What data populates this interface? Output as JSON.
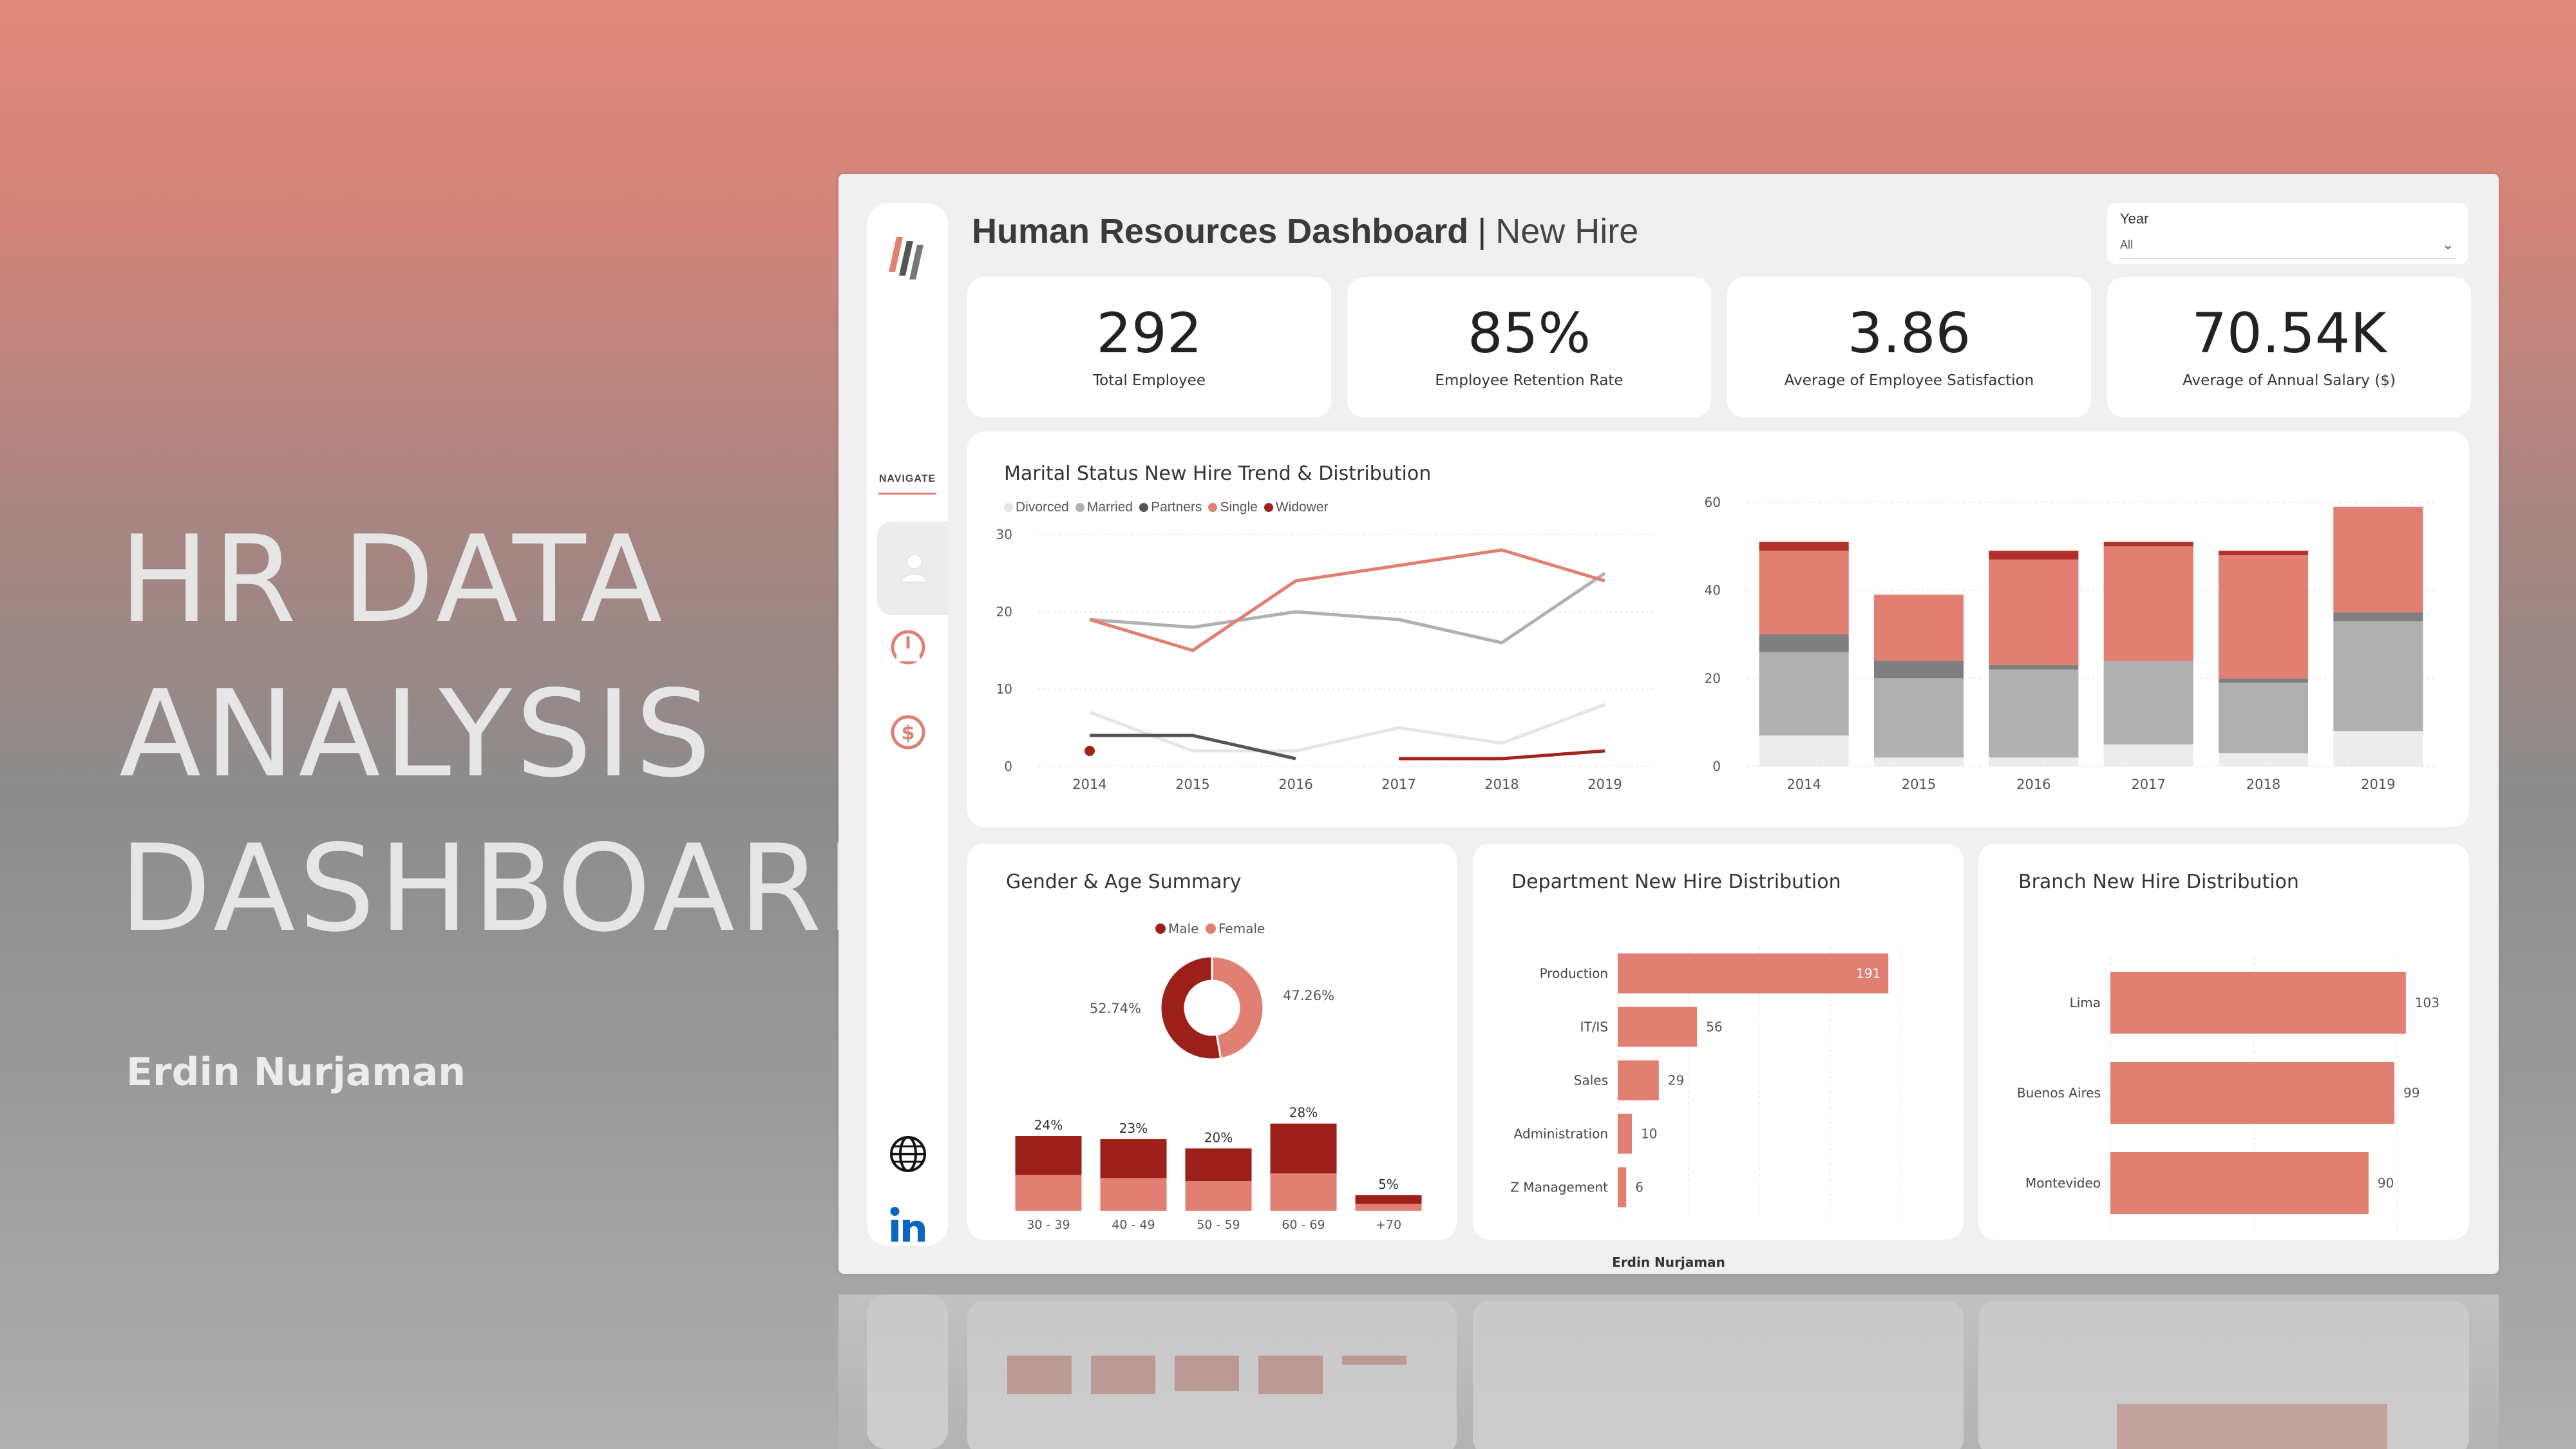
{
  "hero": {
    "title_lines": [
      "HR DATA",
      "ANALYSIS",
      "DASHBOARD"
    ],
    "author": "Erdin Nurjaman"
  },
  "colors": {
    "accent": "#e07f72",
    "dark_red": "#9c1f1a",
    "mid_red": "#b73532",
    "light_gray": "#e8e8e8",
    "gray": "#b3b3b3",
    "dark_gray": "#5a5a5a"
  },
  "sidebar": {
    "nav_label": "NAVIGATE",
    "icons": [
      "user-icon",
      "gauge-icon",
      "dollar-icon",
      "globe-icon",
      "linkedin-icon"
    ]
  },
  "header": {
    "title": "Human Resources Dashboard",
    "separator": "|",
    "subtitle": "New Hire"
  },
  "filter": {
    "label": "Year",
    "value": "All"
  },
  "kpis": [
    {
      "value": "292",
      "label": "Total Employee"
    },
    {
      "value": "85%",
      "label": "Employee Retention Rate"
    },
    {
      "value": "3.86",
      "label": "Average of Employee Satisfaction"
    },
    {
      "value": "70.54K",
      "label": "Average of Annual Salary ($)"
    }
  ],
  "marital_panel": {
    "title": "Marital Status New Hire Trend & Distribution"
  },
  "gender_panel": {
    "title": "Gender & Age Summary"
  },
  "department_panel": {
    "title": "Department New Hire Distribution"
  },
  "branch_panel": {
    "title": "Branch New Hire Distribution"
  },
  "footer": {
    "author": "Erdin Nurjaman"
  },
  "chart_data": [
    {
      "id": "marital-line",
      "type": "line",
      "x": [
        "2014",
        "2015",
        "2016",
        "2017",
        "2018",
        "2019"
      ],
      "ylim": [
        0,
        30
      ],
      "yticks": [
        0,
        10,
        20,
        30
      ],
      "legend_position": "top-left",
      "series": [
        {
          "name": "Divorced",
          "color": "#e5e5e5",
          "values": [
            7,
            2,
            2,
            5,
            3,
            8
          ]
        },
        {
          "name": "Married",
          "color": "#b0b0b0",
          "values": [
            19,
            18,
            20,
            19,
            16,
            25
          ]
        },
        {
          "name": "Partners",
          "color": "#555555",
          "values": [
            4,
            4,
            1,
            null,
            null,
            null
          ]
        },
        {
          "name": "Single",
          "color": "#e07f72",
          "values": [
            19,
            15,
            24,
            26,
            28,
            24
          ]
        },
        {
          "name": "Widower",
          "color": "#a3221c",
          "values": [
            2,
            null,
            null,
            1,
            1,
            2
          ]
        }
      ]
    },
    {
      "id": "marital-stacked",
      "type": "bar",
      "stacked": true,
      "categories": [
        "2014",
        "2015",
        "2016",
        "2017",
        "2018",
        "2019"
      ],
      "ylim": [
        0,
        60
      ],
      "yticks": [
        0,
        20,
        40,
        60
      ],
      "series": [
        {
          "name": "Divorced",
          "color": "#ececec",
          "values": [
            7,
            2,
            2,
            5,
            3,
            8
          ]
        },
        {
          "name": "Married",
          "color": "#b0b0b0",
          "values": [
            19,
            18,
            20,
            19,
            16,
            25
          ]
        },
        {
          "name": "Partners",
          "color": "#7f7f7f",
          "values": [
            4,
            4,
            1,
            0,
            1,
            2
          ]
        },
        {
          "name": "Single",
          "color": "#e07f72",
          "values": [
            19,
            15,
            24,
            26,
            28,
            24
          ]
        },
        {
          "name": "Widower",
          "color": "#b22f2a",
          "values": [
            2,
            0,
            2,
            1,
            1,
            0
          ]
        }
      ]
    },
    {
      "id": "gender-donut",
      "type": "pie",
      "legend": [
        "Male",
        "Female"
      ],
      "series": [
        {
          "name": "Male",
          "value": 52.74,
          "label": "52.74%",
          "color": "#9c1f1a"
        },
        {
          "name": "Female",
          "value": 47.26,
          "label": "47.26%",
          "color": "#e07f72"
        }
      ]
    },
    {
      "id": "age-bars",
      "type": "bar",
      "stacked": true,
      "categories": [
        "30 - 39",
        "40 - 49",
        "50 - 59",
        "60 - 69",
        "+70"
      ],
      "totals": [
        24,
        23,
        20,
        28,
        5
      ],
      "labels": [
        "24%",
        "23%",
        "20%",
        "28%",
        "5%"
      ],
      "series": [
        {
          "name": "Female",
          "color": "#e07f72",
          "values": [
            11.5,
            10.5,
            9.5,
            12,
            2.2
          ]
        },
        {
          "name": "Male",
          "color": "#9c1f1a",
          "values": [
            12.5,
            12.5,
            10.5,
            16,
            2.8
          ]
        }
      ]
    },
    {
      "id": "department-bars",
      "type": "bar",
      "orientation": "horizontal",
      "categories": [
        "Production",
        "IT/IS",
        "Sales",
        "Administration",
        "Z Management"
      ],
      "values": [
        191,
        56,
        29,
        10,
        6
      ],
      "xlim": [
        0,
        200
      ],
      "xticks": [
        0,
        50,
        100,
        150,
        200
      ],
      "color": "#e07f72"
    },
    {
      "id": "branch-bars",
      "type": "bar",
      "orientation": "horizontal",
      "categories": [
        "Lima",
        "Buenos Aires",
        "Montevideo"
      ],
      "values": [
        103,
        99,
        90
      ],
      "xlim": [
        0,
        110
      ],
      "xticks": [
        0,
        50,
        100
      ],
      "color": "#e07f72"
    }
  ]
}
